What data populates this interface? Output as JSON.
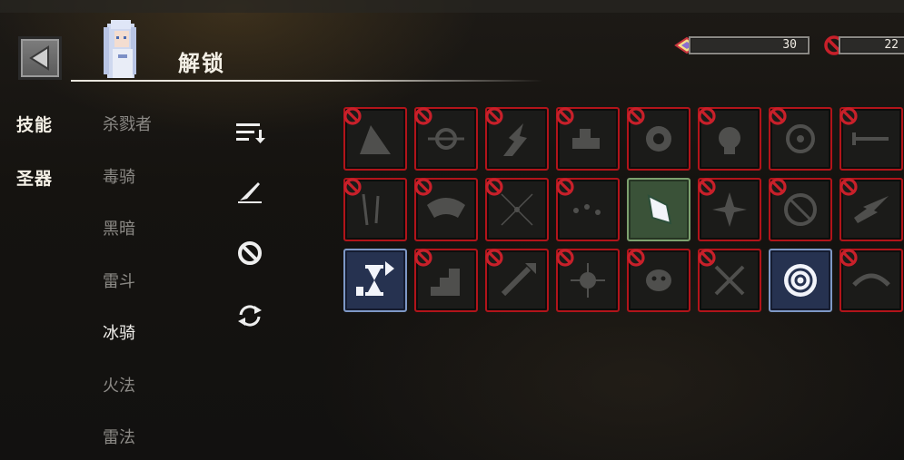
{
  "header": {
    "title": "解锁",
    "back_icon": "back-arrow-icon",
    "resources": [
      {
        "icon": "diamond-icon",
        "value": "30"
      },
      {
        "icon": "ban-icon",
        "value": "22"
      }
    ]
  },
  "categories": [
    {
      "label": "技能"
    },
    {
      "label": "圣器"
    }
  ],
  "classes": [
    {
      "label": "杀戮者"
    },
    {
      "label": "毒骑"
    },
    {
      "label": "黑暗"
    },
    {
      "label": "雷斗"
    },
    {
      "label": "冰骑",
      "active": true
    },
    {
      "label": "火法"
    },
    {
      "label": "雷法"
    }
  ],
  "tools": [
    {
      "icon": "sort-icon"
    },
    {
      "icon": "quill-icon"
    },
    {
      "icon": "ban-filter-icon"
    },
    {
      "icon": "refresh-icon"
    }
  ],
  "colors": {
    "locked_border": "#b2141a",
    "unlocked_green": "#7da16f",
    "unlocked_blue": "#7e98c6",
    "ban_red": "#c8202a"
  },
  "skills": [
    {
      "icon": "ice-shard-icon",
      "state": "locked"
    },
    {
      "icon": "spiked-chain-icon",
      "state": "locked"
    },
    {
      "icon": "lightning-bolt-icon",
      "state": "locked"
    },
    {
      "icon": "anvil-icon",
      "state": "locked"
    },
    {
      "icon": "flame-burst-icon",
      "state": "locked"
    },
    {
      "icon": "skull-burst-icon",
      "state": "locked"
    },
    {
      "icon": "biohazard-icon",
      "state": "locked"
    },
    {
      "icon": "sword-icon",
      "state": "locked"
    },
    {
      "icon": "falling-swords-icon",
      "state": "locked"
    },
    {
      "icon": "demon-wings-icon",
      "state": "locked"
    },
    {
      "icon": "shatter-icon",
      "state": "locked"
    },
    {
      "icon": "scatter-icon",
      "state": "locked"
    },
    {
      "icon": "ice-claw-icon",
      "state": "unlocked-green"
    },
    {
      "icon": "shuriken-icon",
      "state": "locked"
    },
    {
      "icon": "rune-circle-icon",
      "state": "locked"
    },
    {
      "icon": "thunder-streak-icon",
      "state": "locked"
    },
    {
      "icon": "hourglass-upgrade-icon",
      "state": "unlocked-blue"
    },
    {
      "icon": "stairs-upgrade-icon",
      "state": "locked"
    },
    {
      "icon": "sword-upgrade-icon",
      "state": "locked"
    },
    {
      "icon": "spiked-orb-icon",
      "state": "locked"
    },
    {
      "icon": "demon-face-icon",
      "state": "locked"
    },
    {
      "icon": "crossed-axes-icon",
      "state": "locked"
    },
    {
      "icon": "vortex-icon",
      "state": "unlocked-blue"
    },
    {
      "icon": "crescent-slash-icon",
      "state": "locked"
    }
  ]
}
